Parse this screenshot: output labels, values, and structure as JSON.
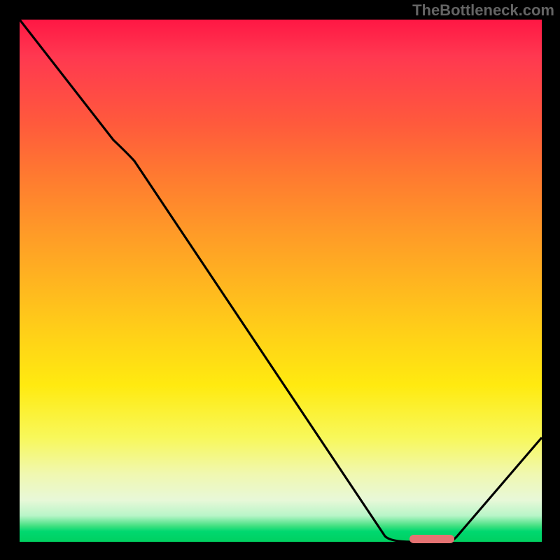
{
  "watermark": "TheBottleneck.com",
  "chart_data": {
    "type": "line",
    "title": "",
    "xlabel": "",
    "ylabel": "",
    "xlim": [
      0,
      100
    ],
    "ylim": [
      0,
      100
    ],
    "series": [
      {
        "name": "curve",
        "x": [
          0,
          18,
          22,
          70,
          75,
          82,
          100
        ],
        "values": [
          100,
          77,
          74,
          1,
          0,
          0,
          20
        ]
      }
    ],
    "marker": {
      "x_start": 75,
      "x_end": 83,
      "y": 0.5,
      "color": "#e57373"
    },
    "background_gradient": {
      "type": "vertical",
      "stops": [
        {
          "pos": 0.0,
          "color": "#ff1744"
        },
        {
          "pos": 0.5,
          "color": "#ffb420"
        },
        {
          "pos": 0.8,
          "color": "#f8f85a"
        },
        {
          "pos": 0.97,
          "color": "#40e080"
        },
        {
          "pos": 1.0,
          "color": "#00d060"
        }
      ]
    }
  }
}
